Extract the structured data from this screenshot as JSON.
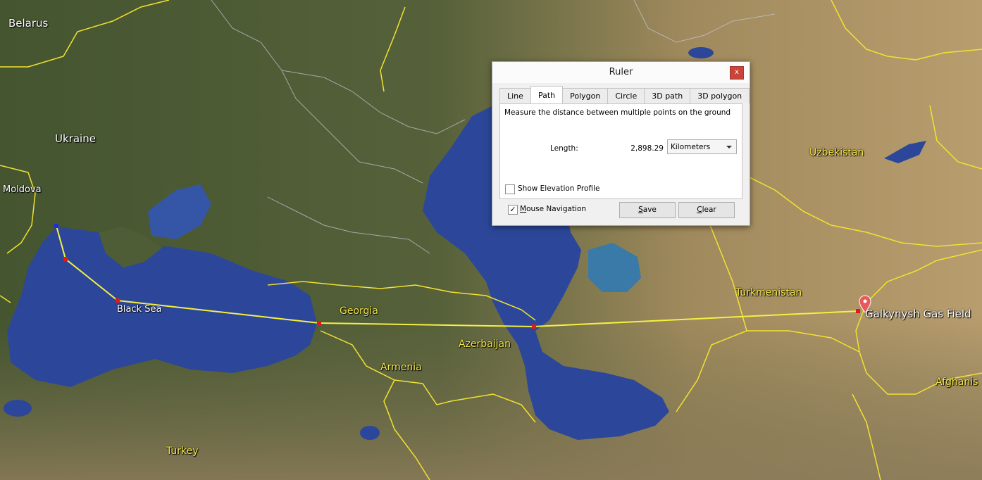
{
  "map": {
    "labels": {
      "belarus": "Belarus",
      "ukraine": "Ukraine",
      "moldova": "Moldova",
      "black_sea": "Black Sea",
      "georgia": "Georgia",
      "azerbaijan": "Azerbaijan",
      "armenia": "Armenia",
      "turkey": "Turkey",
      "turkmenistan": "Turkmenistan",
      "uzbekistan": "Uzbekistan",
      "afghanistan": "Afghanis",
      "gas_field": "Galkynysh Gas Field"
    },
    "colors": {
      "path": "#f5f042",
      "border": "#f2e230",
      "water": "#2f4a9a",
      "land": "#4d5d35",
      "desert": "#b79a6b"
    },
    "marker_icon": "placemark-icon"
  },
  "ruler": {
    "title": "Ruler",
    "close_label": "x",
    "tabs": [
      "Line",
      "Path",
      "Polygon",
      "Circle",
      "3D path",
      "3D polygon"
    ],
    "active_tab": "Path",
    "description": "Measure the distance between multiple points on the ground",
    "length_label": "Length:",
    "length_value": "2,898.29",
    "units": "Kilometers",
    "show_elevation_label": "Show Elevation Profile",
    "show_elevation_checked": false,
    "mouse_navigation_label": "Mouse Navigation",
    "mouse_navigation_checked": true,
    "check_mark": "✓",
    "save_label": "Save",
    "clear_label": "Clear"
  }
}
